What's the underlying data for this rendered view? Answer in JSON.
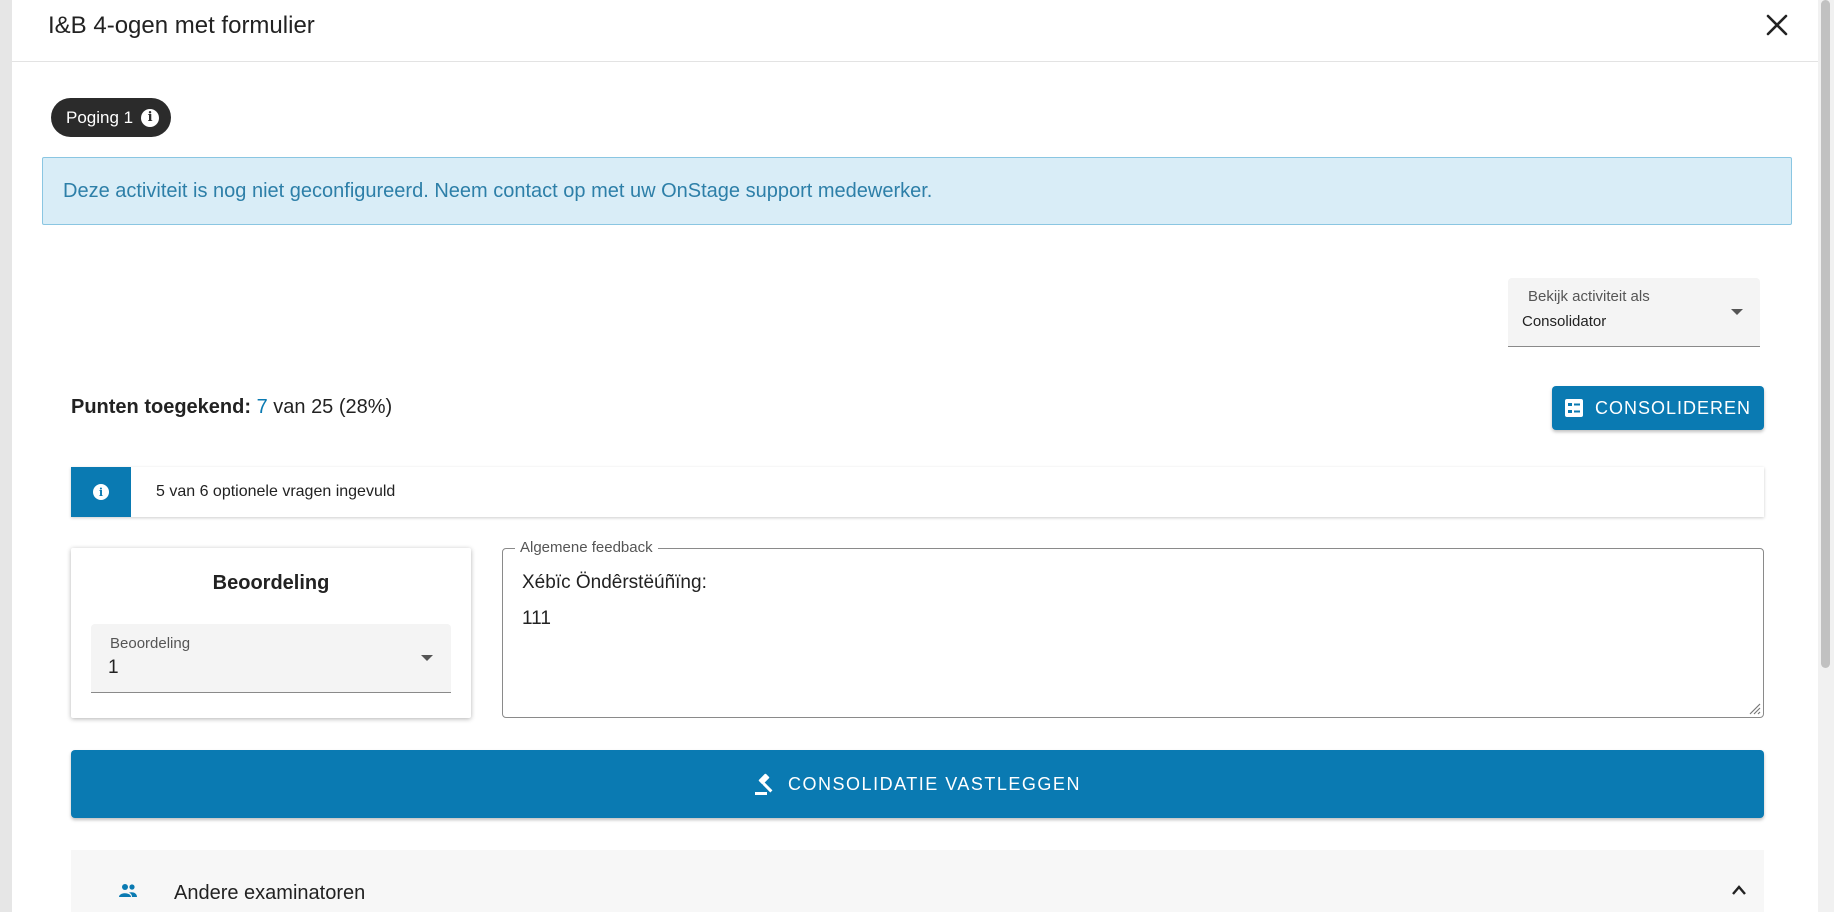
{
  "dialog": {
    "title": "I&B 4-ogen met formulier",
    "close_icon": "close-icon"
  },
  "attempt_chip": {
    "label": "Poging 1",
    "icon": "info-icon"
  },
  "alert": {
    "text": "Deze activiteit is nog niet geconfigureerd. Neem contact op met uw OnStage support medewerker.",
    "color": "#2d7fa8"
  },
  "view_as": {
    "label": "Bekijk activiteit als",
    "value": "Consolidator"
  },
  "points": {
    "label": "Punten toegekend:",
    "earned": "7",
    "rest": " van 25 (28%)"
  },
  "consolidate_button": {
    "label": "CONSOLIDEREN",
    "icon": "checklist-icon",
    "color": "#0a7ab2"
  },
  "info_bar": {
    "text": "5 van 6 optionele vragen ingevuld",
    "icon": "info-icon"
  },
  "assessment": {
    "heading": "Beoordeling",
    "select_label": "Beoordeling",
    "select_value": "1"
  },
  "feedback": {
    "legend": "Algemene feedback",
    "text": "Xébïc Öndêrstëúñïng:\n111"
  },
  "commit_button": {
    "label": "CONSOLIDATIE VASTLEGGEN",
    "icon": "gavel-icon"
  },
  "examiners_panel": {
    "label": "Andere examinatoren",
    "icon": "people-icon",
    "toggle_icon": "chevron-up-icon"
  }
}
